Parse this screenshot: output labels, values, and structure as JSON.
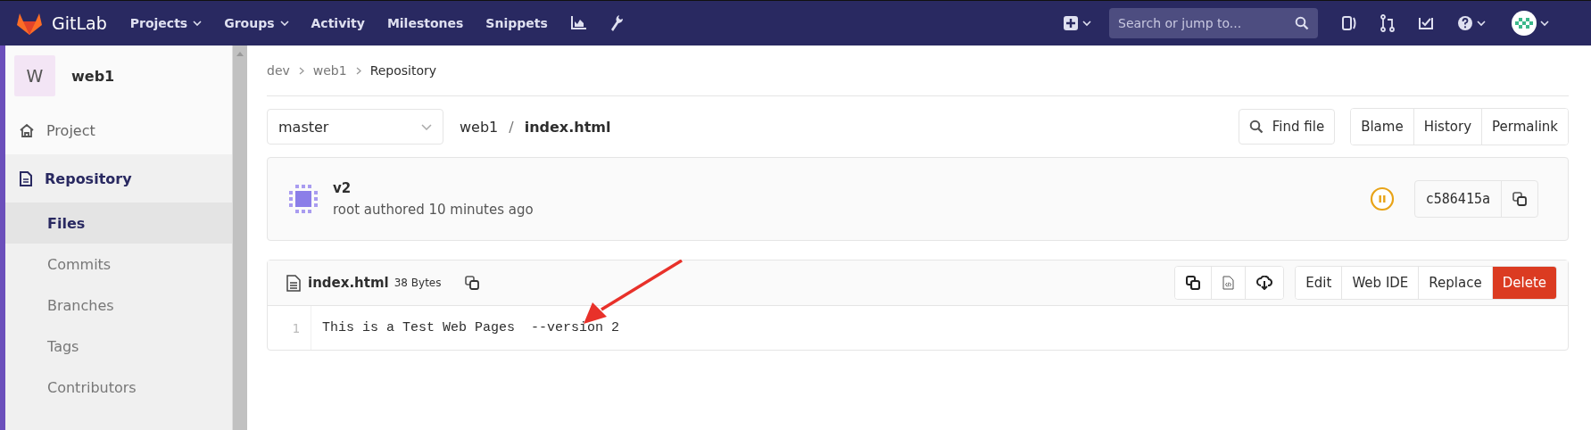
{
  "navbar": {
    "brand": "GitLab",
    "links": [
      {
        "label": "Projects",
        "dropdown": true
      },
      {
        "label": "Groups",
        "dropdown": true
      },
      {
        "label": "Activity",
        "dropdown": false
      },
      {
        "label": "Milestones",
        "dropdown": false
      },
      {
        "label": "Snippets",
        "dropdown": false
      }
    ],
    "search": {
      "placeholder": "Search or jump to..."
    }
  },
  "sidebar": {
    "project_initial": "W",
    "project_name": "web1",
    "items": [
      {
        "label": "Project",
        "selected": false
      },
      {
        "label": "Repository",
        "selected": true,
        "children": [
          {
            "label": "Files",
            "selected": true
          },
          {
            "label": "Commits",
            "selected": false
          },
          {
            "label": "Branches",
            "selected": false
          },
          {
            "label": "Tags",
            "selected": false
          },
          {
            "label": "Contributors",
            "selected": false
          }
        ]
      }
    ]
  },
  "breadcrumb": [
    "dev",
    "web1",
    "Repository"
  ],
  "branch": "master",
  "path": {
    "repo": "web1",
    "separator": "/",
    "file": "index.html"
  },
  "find_file": "Find file",
  "view_buttons": [
    "Blame",
    "History",
    "Permalink"
  ],
  "commit": {
    "title": "v2",
    "meta": "root authored 10 minutes ago",
    "sha": "c586415a"
  },
  "file": {
    "name": "index.html",
    "size": "38 Bytes",
    "actions": [
      {
        "label": "Edit",
        "kind": "plain"
      },
      {
        "label": "Web IDE",
        "kind": "plain"
      },
      {
        "label": "Replace",
        "kind": "plain"
      },
      {
        "label": "Delete",
        "kind": "danger"
      }
    ],
    "lines": [
      {
        "number": "1",
        "text": "This is a Test Web Pages  --version 2"
      }
    ]
  }
}
